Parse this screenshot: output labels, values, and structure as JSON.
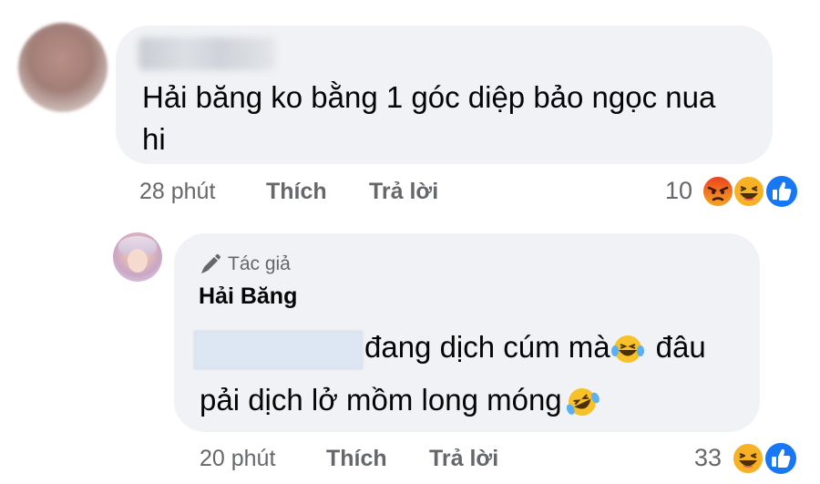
{
  "comment1": {
    "text_line1": "Hải băng ko bằng 1 góc diệp bảo ngọc nua",
    "text_line2": "hi",
    "time": "28 phút",
    "like_label": "Thích",
    "reply_label": "Trả lời",
    "reaction_count": "10",
    "reactions": [
      "angry-icon",
      "haha-icon",
      "like-icon"
    ]
  },
  "comment2": {
    "badge_label": "Tác giả",
    "author_name": "Hải Băng",
    "text_line1": "đang dịch cúm mà",
    "text_line1_tail": "đâu",
    "text_line2": "pải dịch lở mồm long móng",
    "time": "20 phút",
    "like_label": "Thích",
    "reply_label": "Trả lời",
    "reaction_count": "33",
    "reactions": [
      "haha-icon",
      "like-icon"
    ]
  },
  "colors": {
    "bubble": "#f0f2f5",
    "meta_gray": "#65676b",
    "like_blue": "#1877f2",
    "emoji_yellow": "#f7b125"
  }
}
